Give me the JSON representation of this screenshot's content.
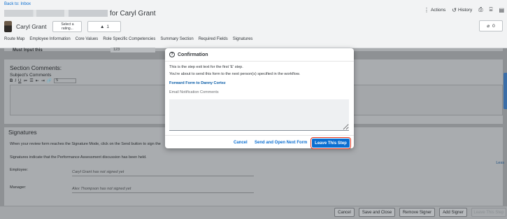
{
  "header": {
    "back_link": "Back to: Inbox",
    "title_suffix": "for Caryl Grant",
    "actions_label": "Actions",
    "history_label": "History",
    "subject_name": "Caryl Grant",
    "rating_line1": "Select a",
    "rating_line2": "rating...",
    "alert_count": "1",
    "attachment_count": "0"
  },
  "nav_tabs": [
    "Route Map",
    "Employee Information",
    "Core Values",
    "Role Specific Competencies",
    "Summary Section",
    "Required Fields",
    "Signatures"
  ],
  "form": {
    "must_input_label": "Must Input this",
    "must_input_value": "123",
    "section_title": "Section Comments:",
    "section_subtitle": "Subject's Comments",
    "rte_tools": [
      "B",
      "I",
      "U",
      "≔",
      "☰",
      "⇤",
      "⇥",
      "🔗"
    ],
    "font_size_value": "5",
    "signatures_title": "Signatures",
    "signatures_info": "When your review form reaches the Signature Mode, click on the Send button to sign the",
    "signatures_note": "Signatures indicate that the Performance Assessment discussion has been held.",
    "employee_label": "Employee:",
    "employee_value": "Caryl Grant has not signed yet",
    "manager_label": "Manager:",
    "manager_value": "Alex Thompson has not signed yet",
    "less_link": "Less"
  },
  "footer_buttons": {
    "cancel": "Cancel",
    "save_close": "Save and Close",
    "remove_signer": "Remove Signer",
    "add_signer": "Add Signer",
    "leave_step": "Leave This Step"
  },
  "dialog": {
    "title": "Confirmation",
    "exit_text": "This is the step exit text for the first 'E' step.",
    "send_text": "You're about to send this form to the next person(s) specified in the workflow.",
    "forward_text": "Forward Form to Danny Cortez",
    "comments_label": "Email Notification Comments",
    "comments_value": "",
    "cancel_label": "Cancel",
    "send_open_label": "Send and Open Next Form",
    "leave_label": "Leave This Step"
  },
  "colors": {
    "accent": "#0a6ed1",
    "highlight_outline": "#e5331b"
  }
}
